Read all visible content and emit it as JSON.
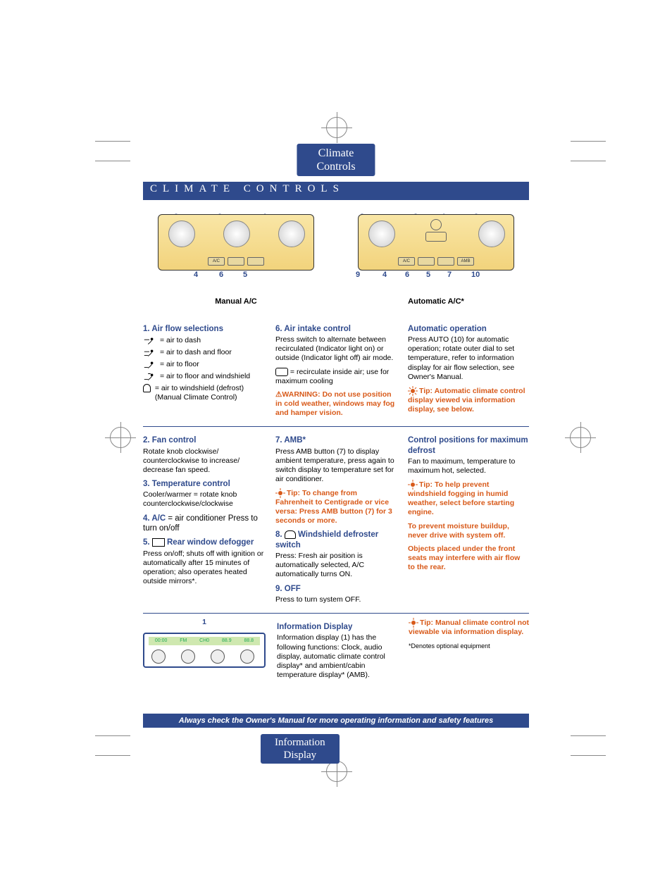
{
  "tabs": {
    "top": "Climate\nControls",
    "bottom": "Information\nDisplay"
  },
  "title": "CLIMATE CONTROLS",
  "panels": {
    "manual": {
      "caption": "Manual A/C",
      "callouts_top": [
        "3",
        "2",
        "1"
      ],
      "callouts_bottom": [
        "4",
        "6",
        "5"
      ]
    },
    "auto": {
      "caption": "Automatic A/C*",
      "callouts_top": [
        "2",
        "8",
        "1",
        "3"
      ],
      "callouts_bottom": [
        "9",
        "4",
        "6",
        "5",
        "7",
        "10"
      ]
    }
  },
  "section1": {
    "heading": "1. Air flow selections",
    "items": [
      "= air to dash",
      "= air to dash and floor",
      "= air to floor",
      "= air to floor and windshield",
      "= air to windshield (defrost) (Manual Climate Control)"
    ]
  },
  "section6": {
    "heading": "6. Air intake control",
    "body": "Press switch to alternate between recirculated (Indicator light on) or outside (Indicator light off) air mode.",
    "recirc": "= recirculate inside air; use for maximum cooling",
    "warning": "WARNING: Do not use        position in cold weather, windows may fog and hamper vision."
  },
  "auto_op": {
    "heading": "Automatic operation",
    "body": "Press AUTO (10) for automatic operation; rotate outer dial to set temperature, refer to information display for air flow selection, see Owner's Manual.",
    "tip": "Tip: Automatic climate control display viewed via information display, see below."
  },
  "section2": {
    "heading": "2. Fan control",
    "body": "Rotate knob clockwise/ counterclockwise to increase/ decrease fan speed."
  },
  "section3": {
    "heading": "3. Temperature control",
    "body": "Cooler/warmer = rotate knob counterclockwise/clockwise"
  },
  "section4": {
    "heading": "4. A/C",
    "body": " = air conditioner Press to turn on/off"
  },
  "section5": {
    "heading": "5.      Rear window defogger",
    "body": "Press on/off; shuts off with ignition or automatically after 15 minutes of operation; also operates heated outside mirrors*."
  },
  "section7": {
    "heading": "7. AMB*",
    "body": "Press AMB button (7) to display ambient temperature, press again to switch display to temperature set for air conditioner.",
    "tip": "Tip: To change from Fahrenheit to Centigrade or vice versa: Press AMB button (7) for 3 seconds or more."
  },
  "section8": {
    "heading": "8.      Windshield defroster switch",
    "body": "Press: Fresh air position is automatically selected, A/C automatically turns ON."
  },
  "section9": {
    "heading": "9. OFF",
    "body": "Press to turn system OFF."
  },
  "max_defrost": {
    "heading": "Control positions for maximum defrost",
    "body": "Fan to maximum, temperature to maximum hot,       selected.",
    "tip1": "Tip: To help prevent windshield fogging in humid weather, select       before starting engine.",
    "tip2": "To prevent moisture buildup, never drive with system off.",
    "tip3": "Objects placed under the front seats may interfere with air flow to the rear."
  },
  "info_display": {
    "heading": "Information Display",
    "body": "Information display (1) has the following functions: Clock, audio display, automatic climate control display* and ambient/cabin temperature display* (AMB).",
    "tip": "Tip: Manual climate control not viewable via information display.",
    "radio_callout": "1",
    "radio_lcd": [
      "00:00",
      "FM",
      "CH0",
      "88.9",
      "88.8"
    ]
  },
  "footnote": "*Denotes optional equipment",
  "footer": "Always check the Owner's Manual for more operating information and safety features"
}
